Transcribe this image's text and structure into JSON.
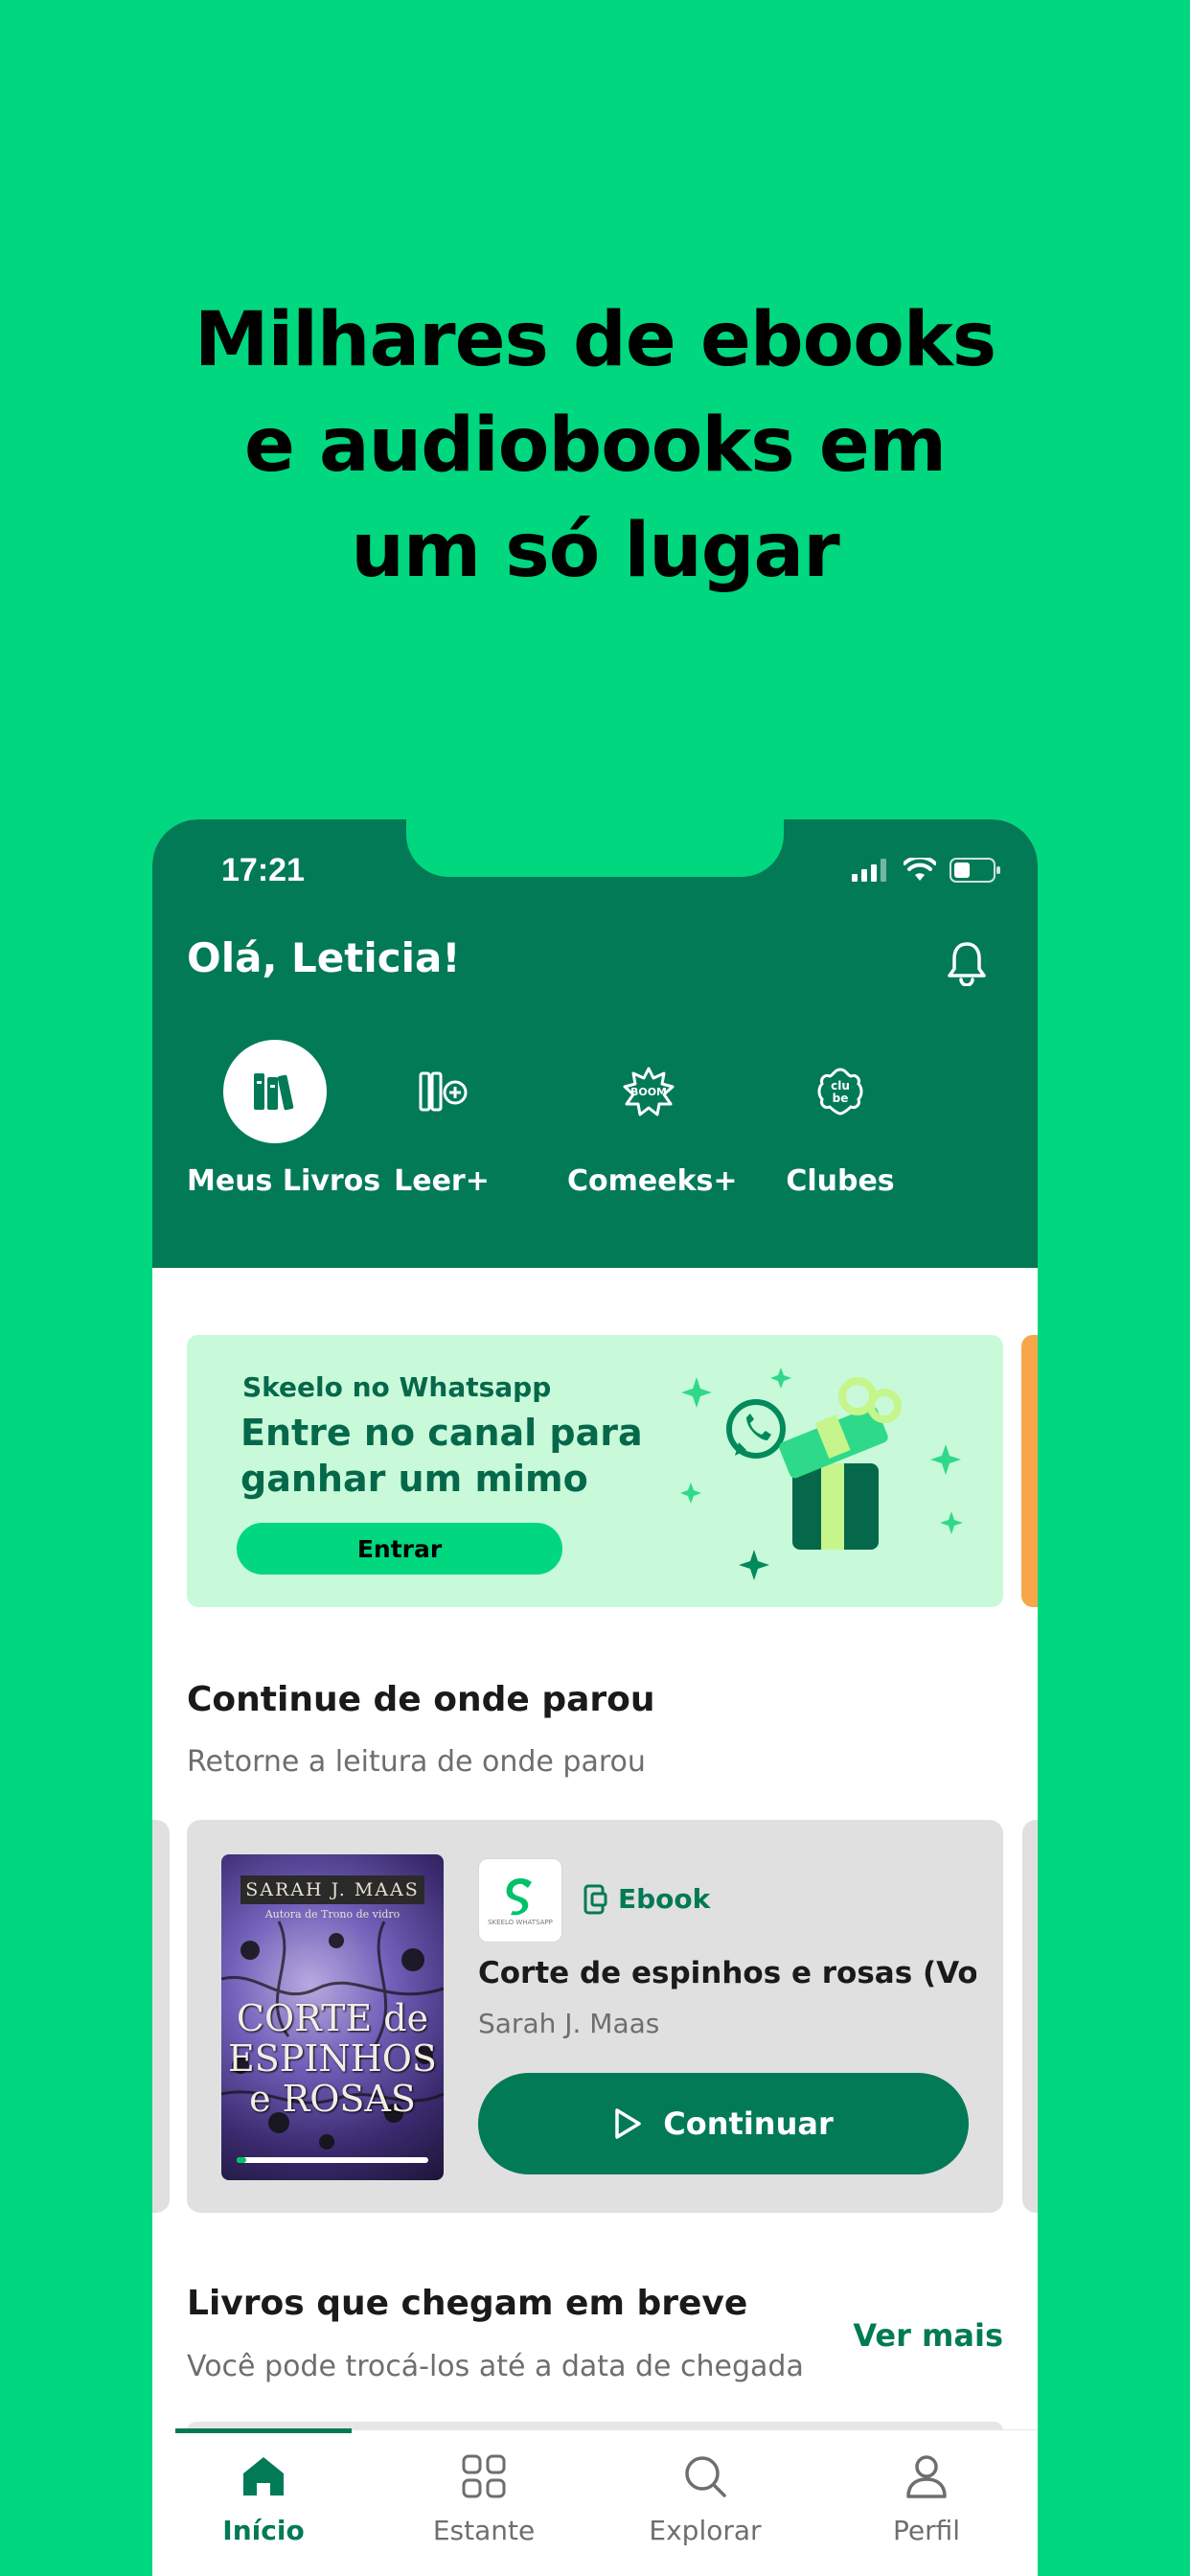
{
  "headline": {
    "line1": "Milhares de ebooks",
    "line2": "e audiobooks em",
    "line3": "um só lugar"
  },
  "status_bar": {
    "time": "17:21"
  },
  "header": {
    "greeting": "Olá, Leticia!",
    "categories": [
      {
        "label": "Meus Livros",
        "icon": "books-icon",
        "active": true
      },
      {
        "label": "Leer+",
        "icon": "add-library-icon",
        "active": false
      },
      {
        "label": "Comeeks+",
        "icon": "comic-burst-icon",
        "active": false
      },
      {
        "label": "Clubes",
        "icon": "club-badge-icon",
        "active": false
      }
    ]
  },
  "banner": {
    "kicker": "Skeelo no Whatsapp",
    "title": "Entre no canal para ganhar um mimo",
    "button": "Entrar"
  },
  "continue_section": {
    "title": "Continue de onde parou",
    "subtitle": "Retorne a leitura de onde parou",
    "book": {
      "cover_author": "SARAH J. MAAS",
      "cover_subtitle": "Autora de Trono de vidro",
      "cover_title_1": "CORTE de",
      "cover_title_2": "ESPINHOS",
      "cover_title_3": "e ROSAS",
      "brand_text": "SKEELO WHATSAPP",
      "format": "Ebook",
      "title": "Corte de espinhos e rosas (Vol....",
      "author": "Sarah J. Maas",
      "progress": 0.05,
      "button": "Continuar"
    }
  },
  "upcoming_section": {
    "title": "Livros que chegam em breve",
    "subtitle": "Você pode trocá-los até a data de chegada",
    "link": "Ver mais"
  },
  "tabbar": {
    "tabs": [
      {
        "label": "Início",
        "icon": "home-icon",
        "active": true
      },
      {
        "label": "Estante",
        "icon": "grid-icon",
        "active": false
      },
      {
        "label": "Explorar",
        "icon": "search-icon",
        "active": false
      },
      {
        "label": "Perfil",
        "icon": "user-icon",
        "active": false
      }
    ]
  },
  "colors": {
    "background": "#00d77f",
    "primary": "#027a55",
    "banner_bg": "#c8fad9",
    "card_bg": "#e0e0e0"
  }
}
